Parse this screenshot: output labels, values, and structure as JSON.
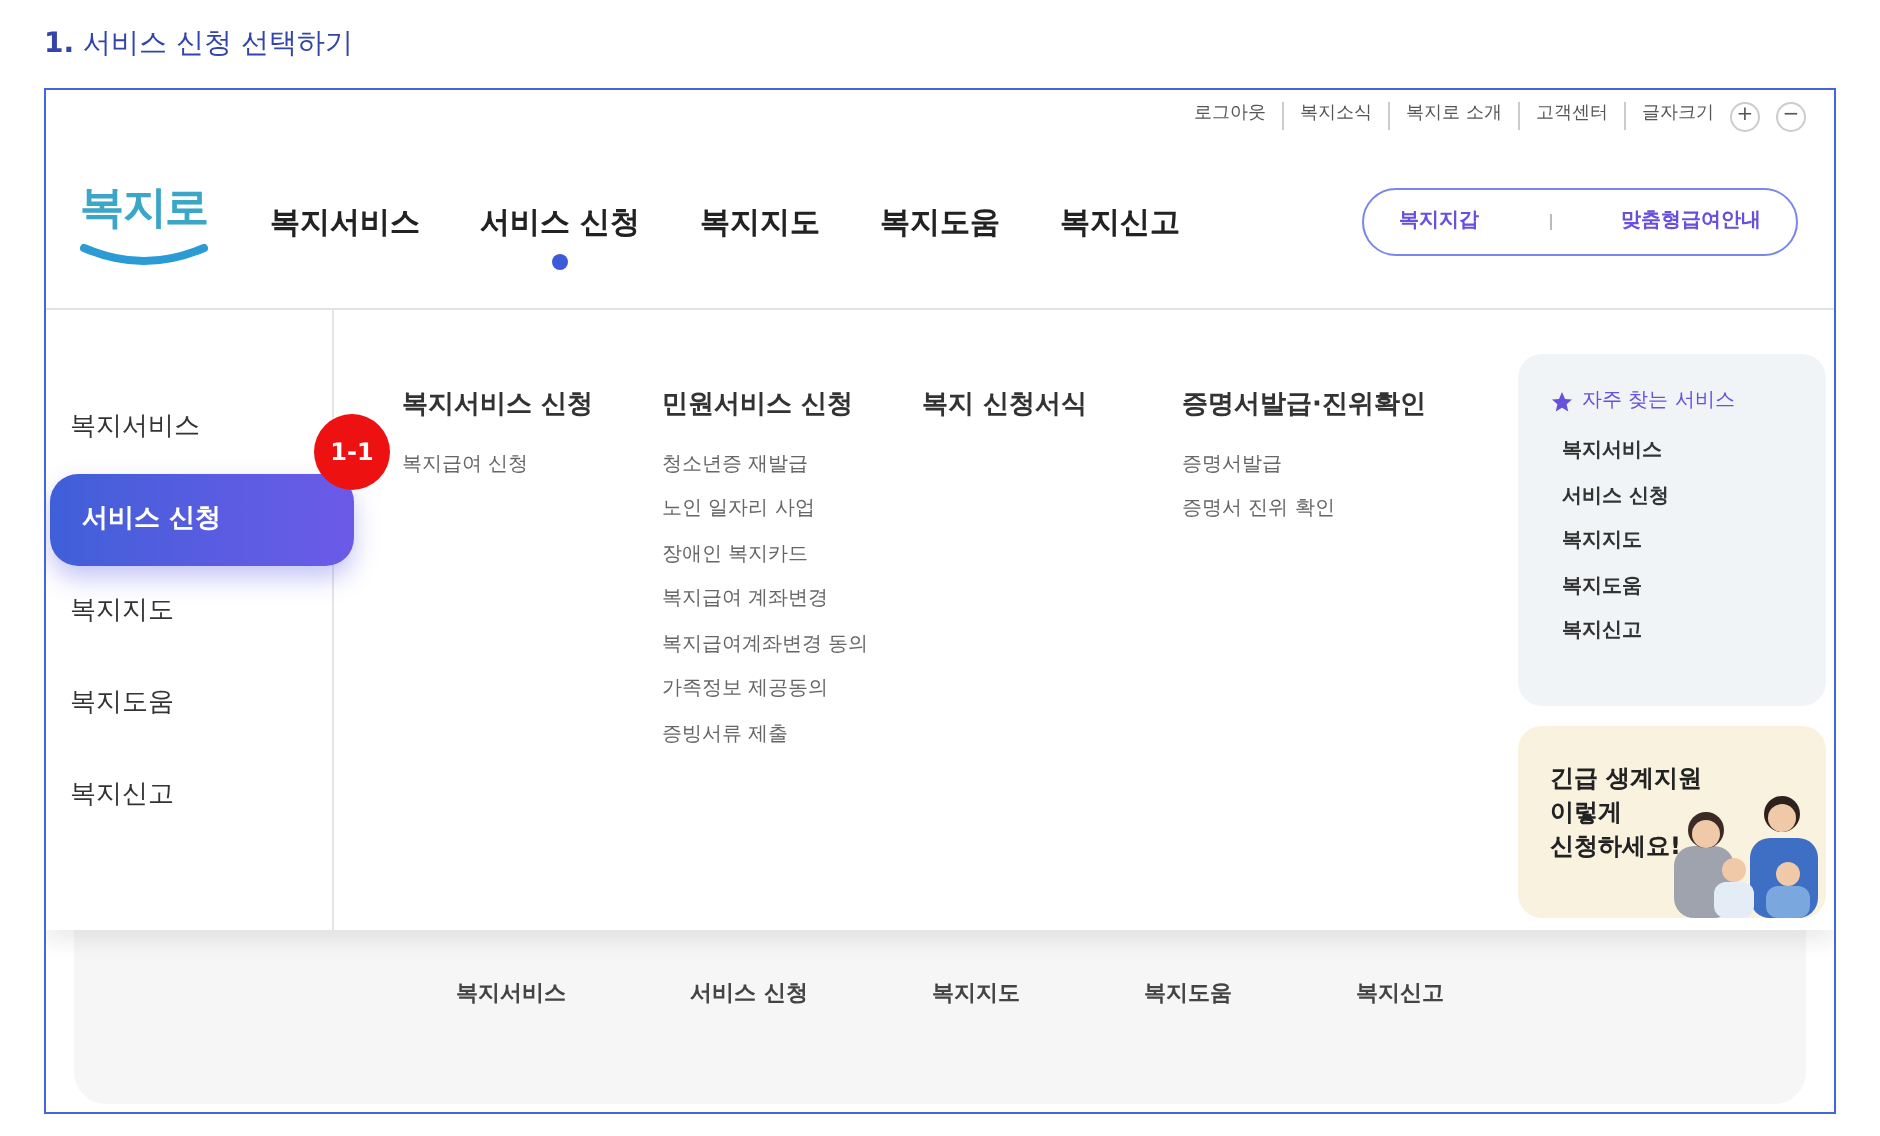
{
  "heading": {
    "number": "1.",
    "text": "서비스 신청 선택하기"
  },
  "utility_links": [
    "로그아웃",
    "복지소식",
    "복지로 소개",
    "고객센터"
  ],
  "font_size": {
    "label": "글자크기",
    "increase": "+",
    "decrease": "−"
  },
  "logo": "복지로",
  "main_nav": [
    {
      "label": "복지서비스",
      "selected": false
    },
    {
      "label": "서비스 신청",
      "selected": true
    },
    {
      "label": "복지지도",
      "selected": false
    },
    {
      "label": "복지도움",
      "selected": false
    },
    {
      "label": "복지신고",
      "selected": false
    }
  ],
  "pill_links": [
    "복지지갑",
    "맞춤형급여안내"
  ],
  "side_menu": [
    {
      "label": "복지서비스",
      "selected": false
    },
    {
      "label": "서비스 신청",
      "selected": true
    },
    {
      "label": "복지지도",
      "selected": false
    },
    {
      "label": "복지도움",
      "selected": false
    },
    {
      "label": "복지신고",
      "selected": false
    }
  ],
  "step_badge": "1-1",
  "menu_columns": [
    {
      "title": "복지서비스 신청",
      "items": [
        "복지급여 신청"
      ]
    },
    {
      "title": "민원서비스 신청",
      "items": [
        "청소년증 재발급",
        "노인 일자리 사업",
        "장애인 복지카드",
        "복지급여 계좌변경",
        "복지급여계좌변경 동의",
        "가족정보 제공동의",
        "증빙서류 제출"
      ]
    },
    {
      "title": "복지 신청서식"
    },
    {
      "title": "증명서발급·진위확인",
      "items": [
        "증명서발급",
        "증명서 진위 확인"
      ]
    }
  ],
  "frequent_services": {
    "title": "자주 찾는 서비스",
    "items": [
      "복지서비스",
      "서비스 신청",
      "복지지도",
      "복지도움",
      "복지신고"
    ]
  },
  "banner": {
    "lines": [
      "긴급 생계지원",
      "이렇게",
      "신청하세요!"
    ],
    "kind": "picture"
  },
  "bottom_nav": [
    "복지서비스",
    "서비스 신청",
    "복지지도",
    "복지도움",
    "복지신고"
  ]
}
